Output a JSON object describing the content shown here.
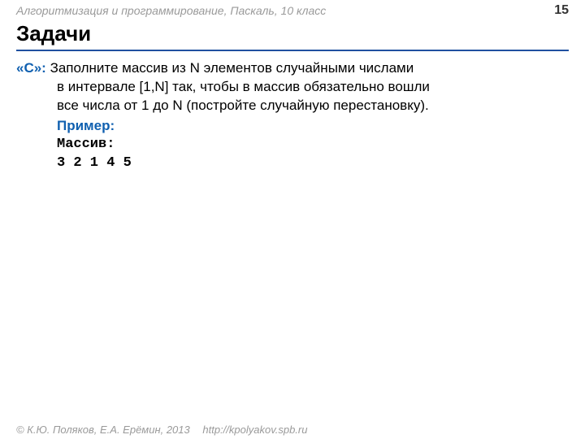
{
  "header": {
    "left": "Алгоритмизация и программирование, Паскаль, 10 класс",
    "page_number": "15"
  },
  "title": "Задачи",
  "task": {
    "label": "«С»: ",
    "line1": "Заполните массив из N элементов случайными числами",
    "line2": "в интервале [1,N] так, чтобы в массив обязательно вошли",
    "line3": "все числа от 1 до N (постройте случайную перестановку)."
  },
  "example": {
    "label": "Пример:",
    "array_label": "Массив:",
    "values": "3 2 1 4 5"
  },
  "footer": {
    "copyright": "© К.Ю. Поляков, Е.А. Ерёмин, 2013",
    "url": "http://kpolyakov.spb.ru"
  }
}
